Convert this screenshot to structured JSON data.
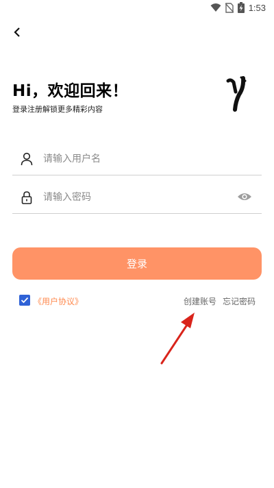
{
  "status_bar": {
    "time": "1:53"
  },
  "header": {
    "back_icon": "chevron-left-icon"
  },
  "welcome": {
    "title": "Hi，欢迎回来！",
    "subtitle": "登录注册解锁更多精彩内容"
  },
  "form": {
    "username_placeholder": "请输入用户名",
    "password_placeholder": "请输入密码",
    "login_label": "登录"
  },
  "agreement": {
    "link_label": "《用户协议》",
    "checked": true
  },
  "links": {
    "create_account": "创建账号",
    "forgot_password": "忘记密码"
  },
  "colors": {
    "accent": "#ff9366",
    "agreement_link": "#ff8a4f",
    "checkbox": "#2f62d6",
    "annotation_arrow": "#d9241b"
  }
}
